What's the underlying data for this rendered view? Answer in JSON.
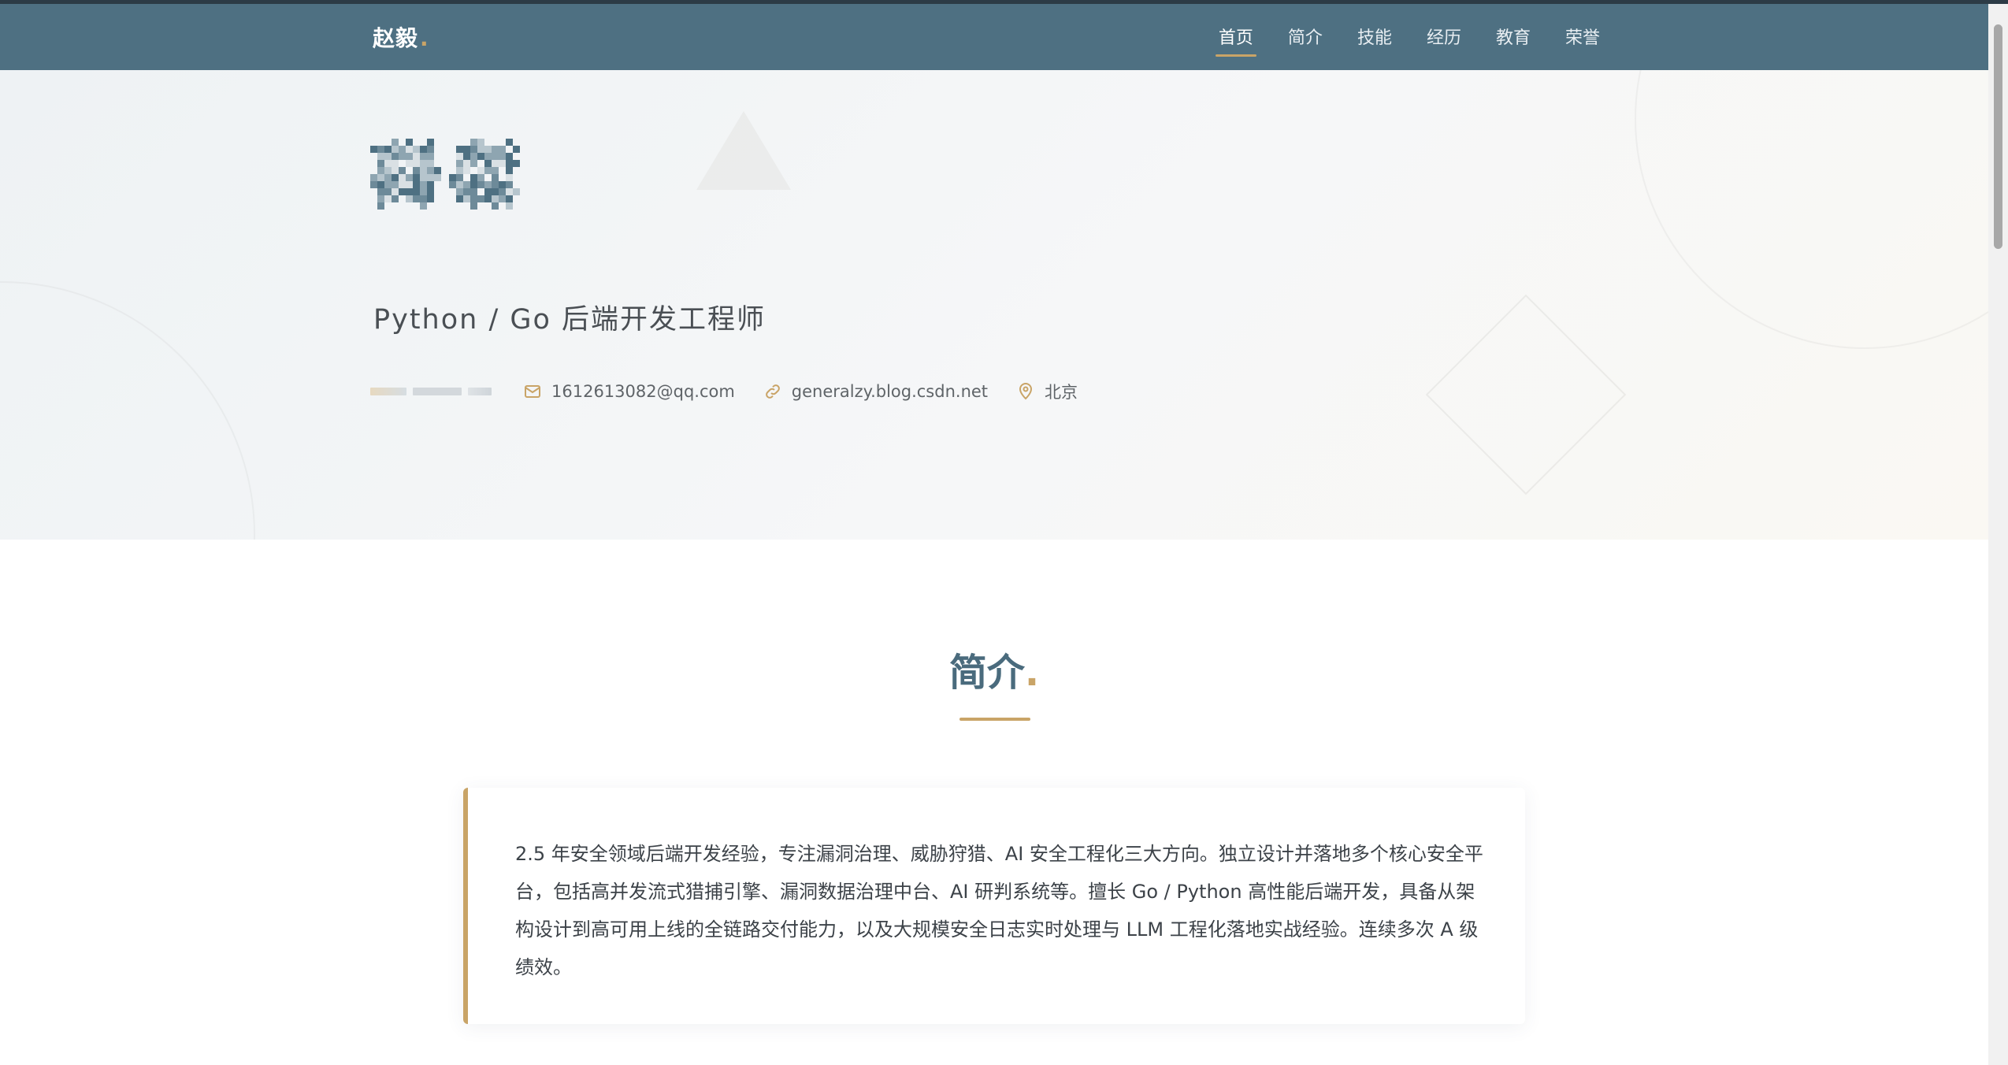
{
  "nav": {
    "brand": "赵毅",
    "brand_dot": ".",
    "items": [
      {
        "label": "首页",
        "active": true
      },
      {
        "label": "简介",
        "active": false
      },
      {
        "label": "技能",
        "active": false
      },
      {
        "label": "经历",
        "active": false
      },
      {
        "label": "教育",
        "active": false
      },
      {
        "label": "荣誉",
        "active": false
      }
    ]
  },
  "hero": {
    "name": "赵毅",
    "subtitle": "Python / Go 后端开发工程师",
    "contacts": {
      "email": "1612613082@qq.com",
      "blog": "generalzy.blog.csdn.net",
      "location": "北京"
    },
    "icons": {
      "email": "mail-icon",
      "blog": "link-icon",
      "location": "location-pin-icon"
    }
  },
  "intro": {
    "title": "简介",
    "title_dot": ".",
    "text": "2.5 年安全领域后端开发经验，专注漏洞治理、威胁狩猎、AI 安全工程化三大方向。独立设计并落地多个核心安全平台，包括高并发流式猎捕引擎、漏洞数据治理中台、AI 研判系统等。擅长 Go / Python 高性能后端开发，具备从架构设计到高可用上线的全链路交付能力，以及大规模安全日志实时处理与 LLM 工程化落地实战经验。连续多次 A 级绩效。"
  },
  "colors": {
    "nav_bg": "#4e7082",
    "accent_gold": "#c9a467",
    "title_blue": "#4a6b7d"
  }
}
